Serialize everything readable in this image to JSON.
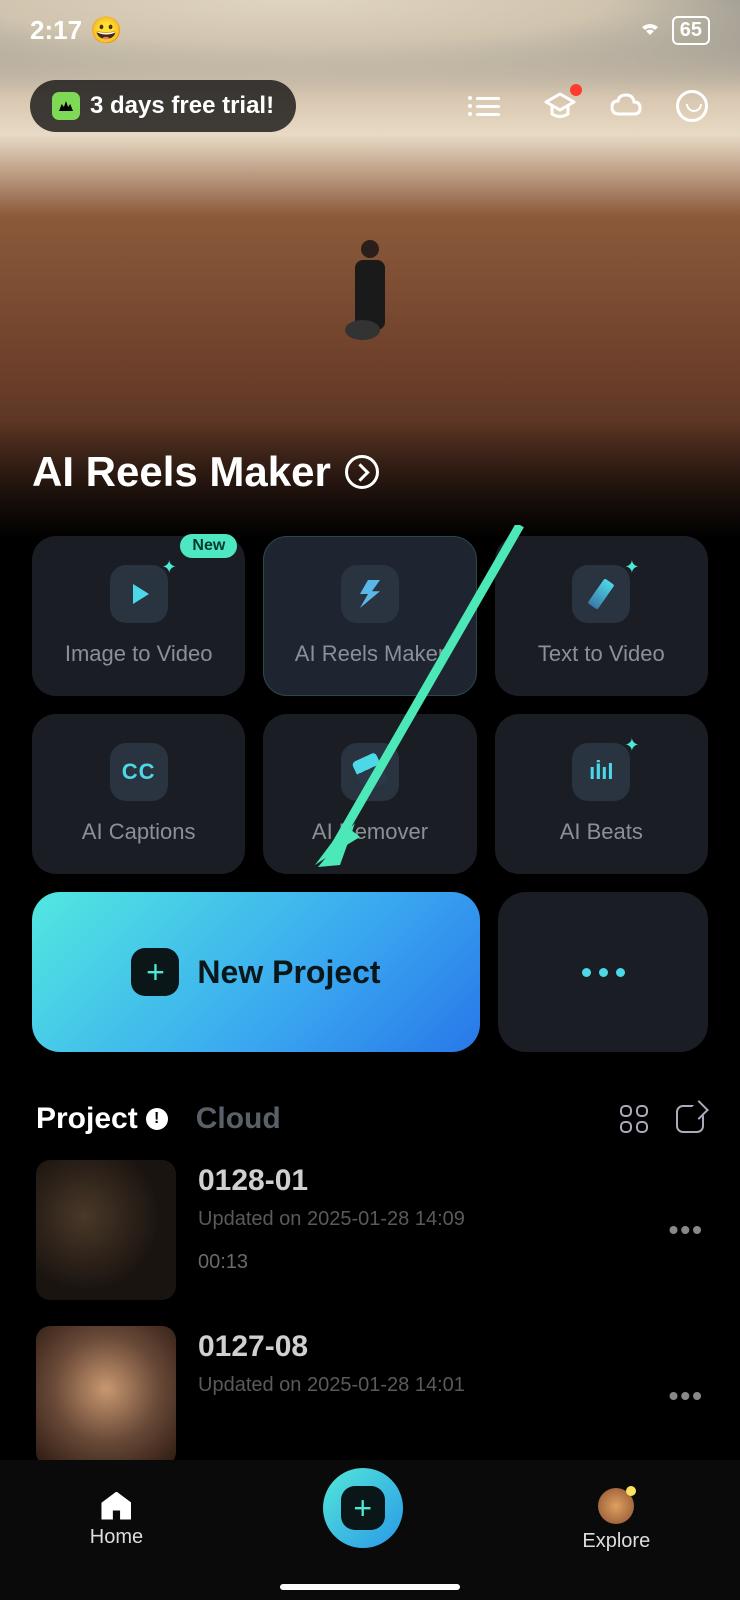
{
  "status": {
    "time": "2:17",
    "emoji": "😀",
    "battery": "65"
  },
  "trial": {
    "label": "3 days free trial!"
  },
  "hero": {
    "title": "AI Reels Maker"
  },
  "tools": [
    {
      "label": "Image to Video",
      "badge": "New"
    },
    {
      "label": "AI Reels Maker"
    },
    {
      "label": "Text  to Video"
    },
    {
      "label": "AI Captions"
    },
    {
      "label": "AI Remover"
    },
    {
      "label": "AI Beats"
    }
  ],
  "new_project": {
    "label": "New Project"
  },
  "tabs": {
    "project": "Project",
    "cloud": "Cloud"
  },
  "projects": [
    {
      "title": "0128-01",
      "updated": "Updated on 2025-01-28 14:09",
      "duration": "00:13"
    },
    {
      "title": "0127-08",
      "updated": "Updated on 2025-01-28 14:01",
      "duration": ""
    }
  ],
  "nav": {
    "home": "Home",
    "explore": "Explore"
  }
}
